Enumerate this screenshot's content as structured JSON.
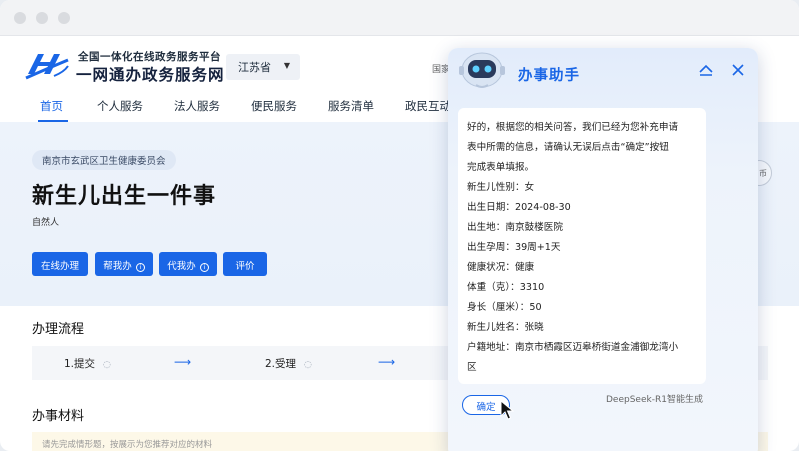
{
  "site": {
    "brand_sub": "全国一体化在线政务服务平台",
    "brand_main": "一网通办政务服务网",
    "province": "江苏省",
    "top_right_partial": "国家"
  },
  "nav": {
    "items": [
      "首页",
      "个人服务",
      "法人服务",
      "便民服务",
      "服务清单",
      "政民互动"
    ],
    "active_index": 0
  },
  "service": {
    "department": "南京市玄武区卫生健康委员会",
    "title": "新生儿出生一件事",
    "subject": "自然人",
    "buttons": [
      {
        "label": "在线办理",
        "info_icon": false
      },
      {
        "label": "帮我办",
        "info_icon": true
      },
      {
        "label": "代我办",
        "info_icon": true
      },
      {
        "label": "评价",
        "info_icon": false
      }
    ],
    "hero_circle_partial": "币"
  },
  "process": {
    "title": "办理流程",
    "steps": [
      "1.提交",
      "2.受理"
    ]
  },
  "materials": {
    "title": "办事材料",
    "notice": "请先完成情形题，按展示为您推荐对应的材料",
    "notice_end": "展"
  },
  "assistant": {
    "title": "办事助手",
    "intro": [
      "好的，根据您的相关问答，我们已经为您补充申请",
      "表中所需的信息，请确认无误后点击“确定”按钮",
      "完成表单填报。"
    ],
    "fields": [
      "新生儿性别：女",
      "出生日期：2024-08-30",
      "出生地：南京鼓楼医院",
      "出生孕周：39周+1天",
      "健康状况：健康",
      "体重（克）：3310",
      "身长（厘米）：50",
      "新生儿姓名：张晓",
      "户籍地址：南京市栖霞区迈皋桥街道金浦御龙湾小",
      "区"
    ],
    "confirm_label": "确定",
    "generated_by": "DeepSeek-R1智能生成"
  },
  "icons": {
    "collapse": "chevron-up-icon",
    "close": "close-icon",
    "robot": "robot-avatar-icon",
    "cursor": "mouse-pointer-icon",
    "chat": "chat-bubble-icon"
  },
  "colors": {
    "primary": "#1a66e6",
    "hero_bg": "#edf3fb",
    "title_text": "#111111"
  }
}
